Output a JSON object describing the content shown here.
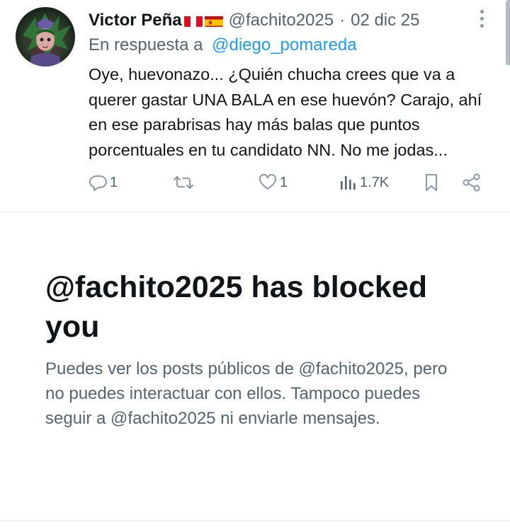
{
  "tweet": {
    "author_name": "Victor Peña",
    "flags": [
      "flag-peru",
      "flag-spain"
    ],
    "handle": "@fachito2025",
    "separator": "·",
    "date": "02 dic 25",
    "reply_prefix": "En respuesta a",
    "reply_handle": "@diego_pomareda",
    "text": "Oye, huevonazo... ¿Quién chucha crees que va a querer gastar UNA BALA en ese huevón? Carajo, ahí en ese parabrisas hay más balas que puntos porcentuales en tu candidato NN. No me jodas...",
    "actions": {
      "reply_count": "1",
      "retweet_count": "",
      "like_count": "1",
      "views_count": "1.7K"
    }
  },
  "blocked": {
    "title": "@fachito2025 has blocked you",
    "description": "Puedes ver los posts públicos de @fachito2025, pero no puedes interactuar con ellos. Tampoco puedes seguir a @fachito2025 ni enviarle mensajes."
  },
  "colors": {
    "text_primary": "#0f1419",
    "text_secondary": "#536471",
    "link": "#1d9bf0",
    "divider": "#eff3f4"
  }
}
